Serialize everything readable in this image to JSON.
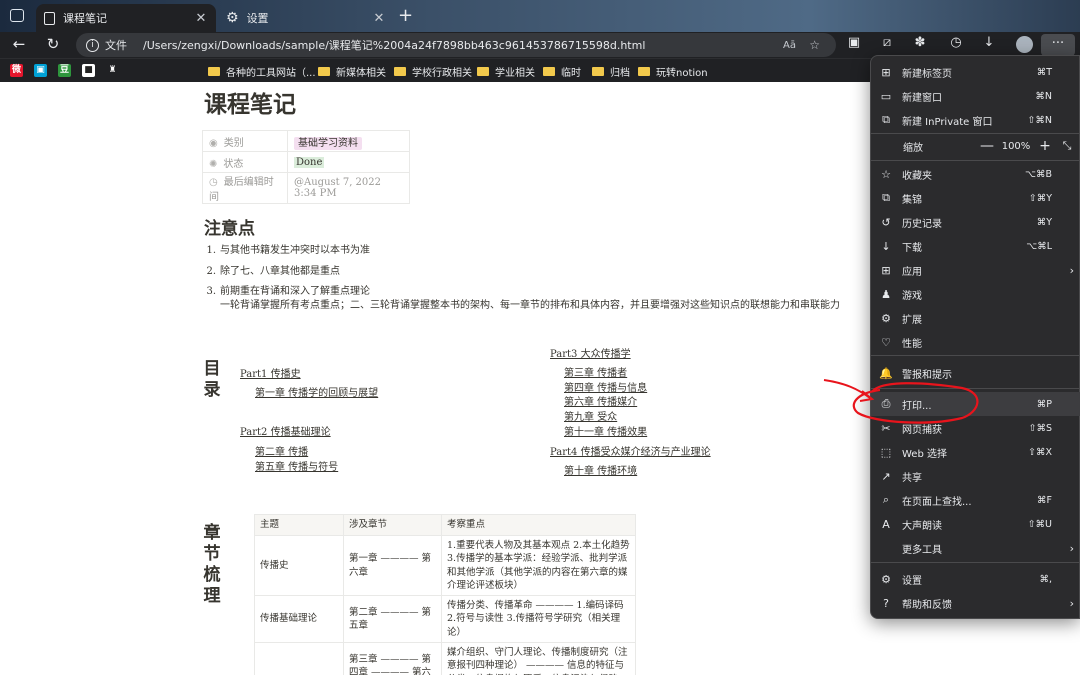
{
  "tabs": [
    {
      "title": "课程笔记",
      "close": "✕"
    },
    {
      "title": "设置",
      "close": "✕"
    }
  ],
  "new_tab": "+",
  "address": {
    "info": "i",
    "label": "文件",
    "url": "/Users/zengxi/Downloads/sample/课程笔记%2004a24f7898bb463c961453786715598d.html",
    "read_aloud": "Aā",
    "fav": "☆"
  },
  "favorites": [
    {
      "label": "各种的工具网站（..."
    },
    {
      "label": "新媒体相关"
    },
    {
      "label": "学校行政相关"
    },
    {
      "label": "学业相关"
    },
    {
      "label": "临时"
    },
    {
      "label": "归档"
    },
    {
      "label": "玩转notion"
    }
  ],
  "fav_icons": [
    {
      "text": "微",
      "color": "#e6162d"
    },
    {
      "text": "▣",
      "color": "#00a1d6"
    },
    {
      "text": "豆",
      "color": "#2e963d"
    },
    {
      "text": "■",
      "color": "#222"
    },
    {
      "text": "♜",
      "color": "#444"
    }
  ],
  "page": {
    "title": "课程笔记",
    "props": [
      {
        "key": "类别",
        "value": "基础学习资料",
        "icon": "◉"
      },
      {
        "key": "状态",
        "value": "Done",
        "icon": "✺"
      },
      {
        "key": "最后编辑时间",
        "value": "@August 7, 2022 3:34 PM",
        "icon": "◷"
      }
    ],
    "notes_heading": "注意点",
    "notes": [
      {
        "n": "1.",
        "text": "与其他书籍发生冲突时以本书为准"
      },
      {
        "n": "2.",
        "text": "除了七、八章其他都是重点"
      },
      {
        "n": "3.",
        "text": "前期重在背诵和深入了解重点理论",
        "sub": "一轮背诵掌握所有考点重点；二、三轮背诵掌握整本书的架构、每一章节的排布和具体内容，并且要增强对这些知识点的联想能力和串联能力"
      }
    ],
    "toc_heading": [
      "目",
      "录"
    ],
    "toc_left": [
      "Part1 传播史",
      "第一章 传播学的回顾与展望",
      "Part2 传播基础理论",
      "第二章 传播",
      "第五章 传播与符号"
    ],
    "toc_right": [
      "Part3 大众传播学",
      "第三章 传播者",
      "第四章 传播与信息",
      "第六章 传播媒介",
      "第九章 受众",
      "第十一章 传播效果",
      "Part4 传播受众媒介经济与产业理论",
      "第十章 传播环境"
    ],
    "chapters_heading": [
      "章",
      "节",
      "梳",
      "理"
    ],
    "table": {
      "headers": [
        "主题",
        "涉及章节",
        "考察重点"
      ],
      "rows": [
        [
          "传播史",
          "第一章 ———— 第六章",
          "1.重要代表人物及其基本观点 2.本土化趋势 3.传播学的基本学派：经验学派、批判学派和其他学派（其他学派的内容在第六章的媒介理论评述板块）"
        ],
        [
          "传播基础理论",
          "第二章 ———— 第五章",
          "传播分类、传播革命 ———— 1.编码译码 2.符号与读性 3.传播符号学研究（相关理论）"
        ],
        [
          "",
          "第三章 ———— 第四章 ———— 第六章",
          "媒介组织、守门人理论、传播制度研究（注意报刊四种理论） ———— 信息的特征与分类、信息爆炸与匮乏、信息污染与侵略 ———— 媒介类型和媒介理论（麦克卢汉"
        ]
      ]
    }
  },
  "menu": {
    "items": [
      {
        "icon": "⊞",
        "label": "新建标签页",
        "sc": "⌘T"
      },
      {
        "icon": "▭",
        "label": "新建窗口",
        "sc": "⌘N"
      },
      {
        "icon": "⧉",
        "label": "新建 InPrivate 窗口",
        "sc": "⇧⌘N"
      },
      {
        "icon": "☆",
        "label": "收藏夹",
        "sc": "⌥⌘B"
      },
      {
        "icon": "⧉",
        "label": "集锦",
        "sc": "⇧⌘Y"
      },
      {
        "icon": "↺",
        "label": "历史记录",
        "sc": "⌘Y"
      },
      {
        "icon": "↓",
        "label": "下载",
        "sc": "⌥⌘L"
      },
      {
        "icon": "⊞",
        "label": "应用",
        "sc": "",
        "arrow": "›"
      },
      {
        "icon": "♟",
        "label": "游戏",
        "sc": ""
      },
      {
        "icon": "⚙",
        "label": "扩展",
        "sc": ""
      },
      {
        "icon": "♡",
        "label": "性能",
        "sc": ""
      },
      {
        "icon": "🔔",
        "label": "警报和提示",
        "sc": ""
      },
      {
        "icon": "⎙",
        "label": "打印...",
        "sc": "⌘P"
      },
      {
        "icon": "✂",
        "label": "网页捕获",
        "sc": "⇧⌘S"
      },
      {
        "icon": "⬚",
        "label": "Web 选择",
        "sc": "⇧⌘X"
      },
      {
        "icon": "↗",
        "label": "共享",
        "sc": ""
      },
      {
        "icon": "⌕",
        "label": "在页面上查找...",
        "sc": "⌘F"
      },
      {
        "icon": "A",
        "label": "大声朗读",
        "sc": "⇧⌘U"
      },
      {
        "icon": "",
        "label": "更多工具",
        "sc": "",
        "arrow": "›"
      },
      {
        "icon": "⚙",
        "label": "设置",
        "sc": "⌘,"
      },
      {
        "icon": "?",
        "label": "帮助和反馈",
        "sc": "",
        "arrow": "›"
      }
    ],
    "zoom": {
      "label": "缩放",
      "minus": "—",
      "value": "100%",
      "plus": "+",
      "fullscreen": "⤡"
    }
  }
}
